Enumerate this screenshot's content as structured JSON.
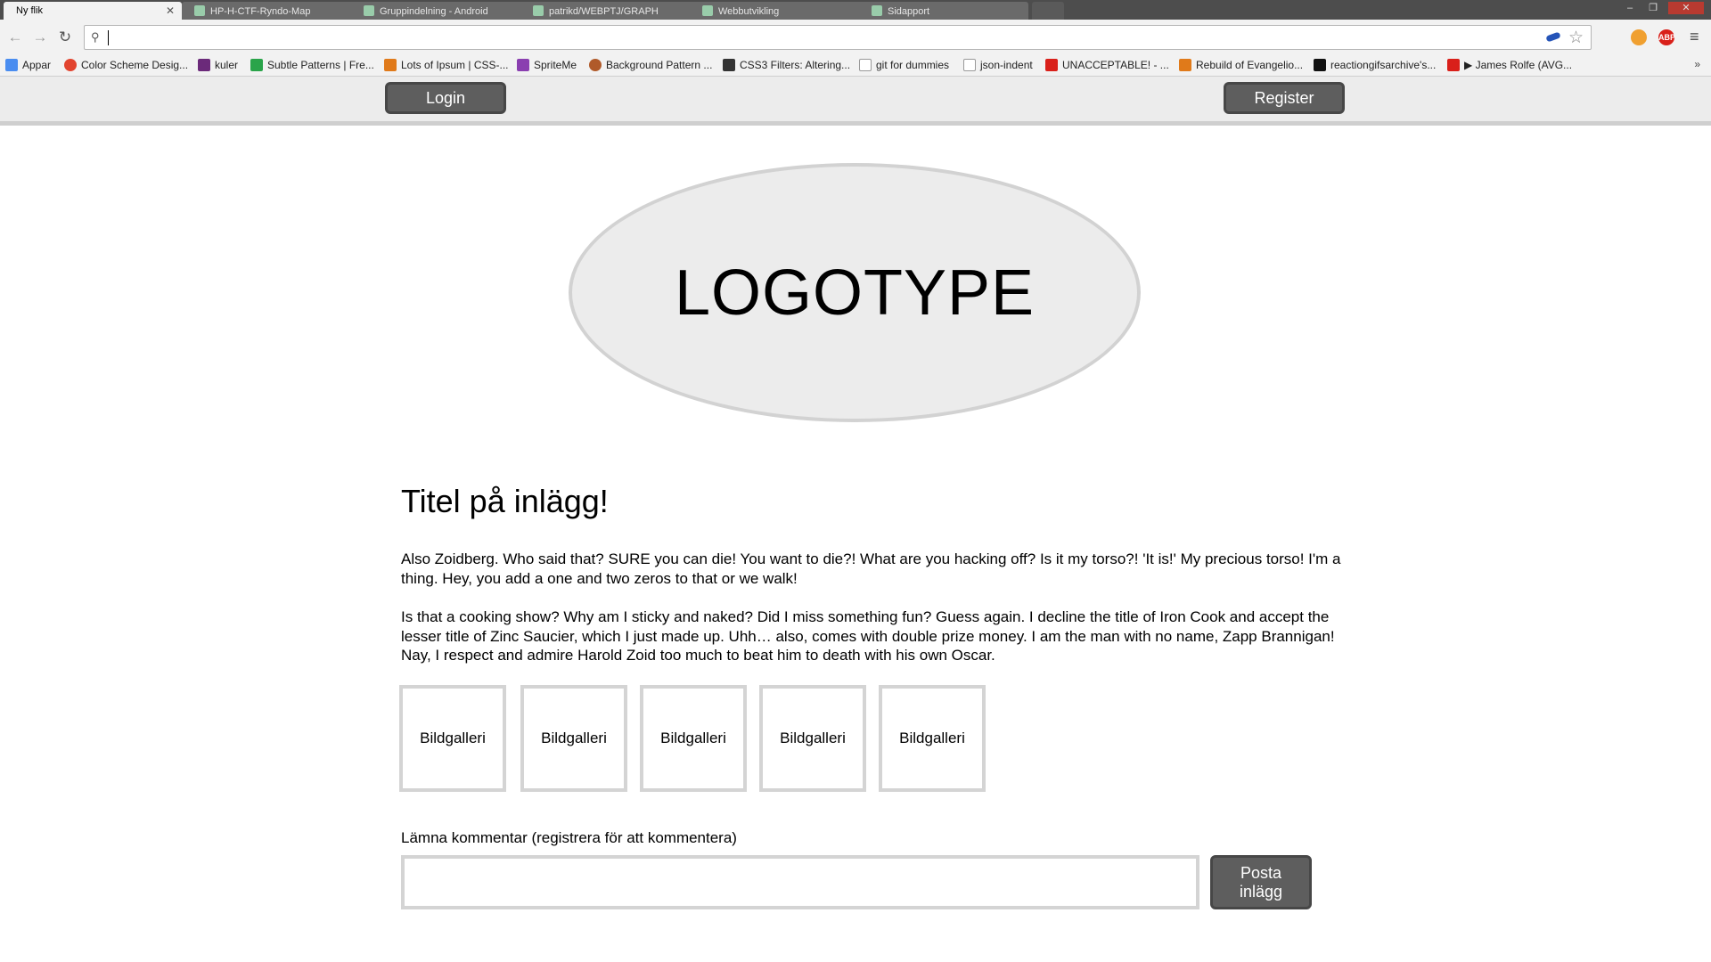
{
  "browser": {
    "tabs": [
      {
        "label": "Ny flik",
        "active": true
      },
      {
        "label": "HP-H-CTF-Ryndo-Map",
        "active": false
      },
      {
        "label": "Gruppindelning - Android",
        "active": false
      },
      {
        "label": "patrikd/WEBPTJ/GRAPH",
        "active": false
      },
      {
        "label": "Webbutvikling",
        "active": false
      },
      {
        "label": "Sidapport",
        "active": false
      }
    ],
    "window_controls": [
      "–",
      "❐",
      "✕"
    ],
    "bookmarks": [
      {
        "label": "Appar",
        "icon": "apps-grid-icon",
        "color": "#4a8df0"
      },
      {
        "label": "Color Scheme Desig...",
        "icon": "color-wheel-icon",
        "color": "#e2442f"
      },
      {
        "label": "kuler",
        "icon": "kuler-icon",
        "color": "#6b2a7a"
      },
      {
        "label": "Subtle Patterns | Fre...",
        "icon": "subtle-patterns-icon",
        "color": "#2aa44a"
      },
      {
        "label": "Lots of Ipsum | CSS-...",
        "icon": "ipsum-icon",
        "color": "#e07a1a"
      },
      {
        "label": "SpriteMe",
        "icon": "spriteme-icon",
        "color": "#8a3fb0"
      },
      {
        "label": "Background Pattern ...",
        "icon": "pattern-gear-icon",
        "color": "#b05a2a"
      },
      {
        "label": "CSS3 Filters: Altering...",
        "icon": "css3-icon",
        "color": "#333333"
      },
      {
        "label": "git for dummies",
        "icon": "page-icon",
        "color": "#ffffff"
      },
      {
        "label": "json-indent",
        "icon": "page-icon",
        "color": "#ffffff"
      },
      {
        "label": "UNACCEPTABLE! - ...",
        "icon": "youtube-icon",
        "color": "#d9201a"
      },
      {
        "label": "Rebuild of Evangelio...",
        "icon": "evangelion-icon",
        "color": "#e07a1a"
      },
      {
        "label": "reactiongifsarchive's...",
        "icon": "tumblr-icon",
        "color": "#111111"
      },
      {
        "label": "▶ James Rolfe (AVG...",
        "icon": "youtube-icon",
        "color": "#d9201a"
      }
    ],
    "bookmarks_overflow": "»",
    "extensions": [
      {
        "label": "",
        "icon": "cookie-icon",
        "color": "#f0a030"
      },
      {
        "label": "ABP",
        "icon": "adblock-icon",
        "color": "#d9201a"
      }
    ]
  },
  "header": {
    "login_label": "Login",
    "register_label": "Register"
  },
  "logo": {
    "text": "LOGOTYPE"
  },
  "post": {
    "title": "Titel på inlägg!",
    "paragraphs": [
      "Also Zoidberg. Who said that? SURE you can die! You want to die?! What are you hacking off? Is it my torso?! 'It is!' My precious torso! I'm a thing. Hey, you add a one and two zeros to that or we walk!",
      "Is that a cooking show? Why am I sticky and naked? Did I miss something fun? Guess again. I decline the title of Iron Cook and accept the lesser title of Zinc Saucier, which I just made up. Uhh… also, comes with double prize money. I am the man with no name, Zapp Brannigan! Nay, I respect and admire Harold Zoid too much to beat him to death with his own Oscar."
    ],
    "gallery": [
      "Bildgalleri",
      "Bildgalleri",
      "Bildgalleri",
      "Bildgalleri",
      "Bildgalleri"
    ]
  },
  "comment": {
    "label": "Lämna kommentar (registrera för att kommentera)",
    "input_value": "",
    "submit_label_line1": "Posta",
    "submit_label_line2": "inlägg"
  },
  "colors": {
    "button_bg": "#5e5e5e",
    "header_bg": "#ececec",
    "border_gray": "#d4d4d4"
  }
}
